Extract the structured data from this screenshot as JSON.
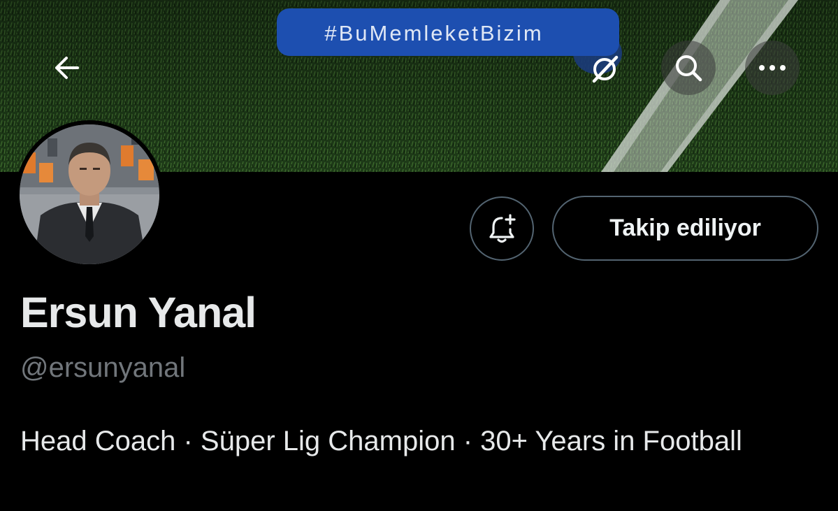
{
  "banner": {
    "hashtag": "#BuMemleketBizim"
  },
  "topbar": {
    "back_icon": "arrow-left-icon",
    "grok_icon": "grok-icon",
    "search_icon": "search-icon",
    "more_icon": "more-horizontal-icon"
  },
  "actions": {
    "notify_icon": "bell-plus-icon",
    "follow_label": "Takip ediliyor"
  },
  "profile": {
    "name": "Ersun Yanal",
    "handle": "@ersunyanal",
    "bio": "Head Coach · Süper Lig Champion · 30+ Years in Football"
  },
  "colors": {
    "background": "#000000",
    "text_primary": "#e7e9ea",
    "text_secondary": "#71767b",
    "border": "#536471",
    "hashtag_pill": "#1d4fb0"
  }
}
